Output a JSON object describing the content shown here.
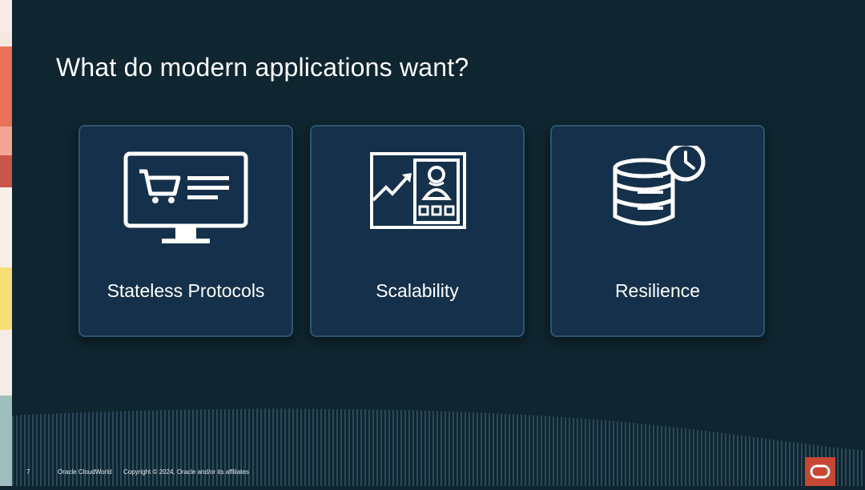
{
  "slide": {
    "title": "What do modern applications want?",
    "cards": [
      {
        "label": "Stateless Protocols",
        "icon": "computer-shopping-cart-icon"
      },
      {
        "label": "Scalability",
        "icon": "growth-profile-chart-icon"
      },
      {
        "label": "Resilience",
        "icon": "database-clock-icon"
      }
    ]
  },
  "footer": {
    "page_number": "7",
    "event": "Oracle CloudWorld",
    "copyright": "Copyright © 2024, Oracle and/or its affiliates",
    "logo_icon": "oracle-logo-icon"
  },
  "colors": {
    "background": "#0f2530",
    "card": "#15304a",
    "card_border": "#2b5572",
    "oracle_red": "#c74634"
  }
}
